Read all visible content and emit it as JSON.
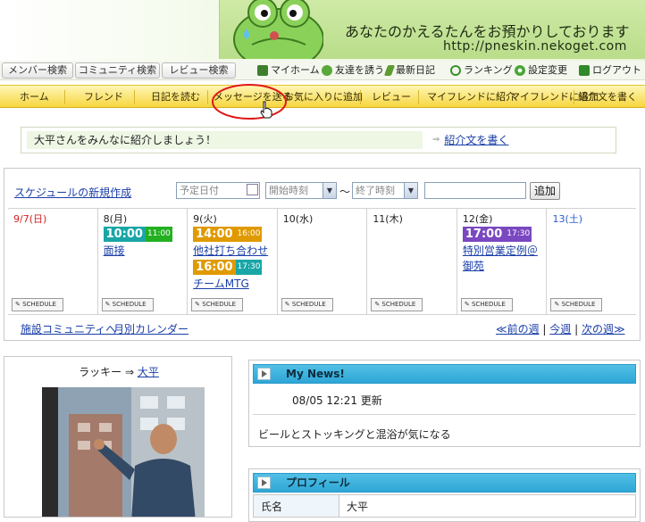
{
  "banner": {
    "title": "あなたのかえるたんをお預かりしております",
    "url": "http://pneskin.nekoget.com"
  },
  "search_tabs": [
    "メンバー検索",
    "コミュニティ検索",
    "レビュー検索"
  ],
  "top_nav": [
    {
      "label": "マイホーム",
      "icon": "home-icon"
    },
    {
      "label": "友達を誘う",
      "icon": "person-icon"
    },
    {
      "label": "最新日記",
      "icon": "pencil-icon"
    },
    {
      "label": "ランキング",
      "icon": "refresh-icon"
    },
    {
      "label": "設定変更",
      "icon": "gear-icon"
    },
    {
      "label": "ログアウト",
      "icon": "exit-icon"
    }
  ],
  "main_nav": [
    "ホーム",
    "フレンド",
    "日記を読む",
    "メッセージを送る",
    "お気に入りに追加",
    "レビュー",
    "マイフレンドに紹介",
    "マイフレンドに追加",
    "紹介文を書く"
  ],
  "intro": {
    "text": "大平さんをみんなに紹介しましょう！",
    "link": "紹介文を書く"
  },
  "schedule": {
    "new_link": "スケジュールの新規作成",
    "date_placeholder": "予定日付",
    "start_placeholder": "開始時刻",
    "tilde": "～",
    "end_placeholder": "終了時刻",
    "add_button": "追加",
    "schedule_btn": "SCHEDULE",
    "days": [
      {
        "label": "9/7(日)",
        "color": "#d42020",
        "events": []
      },
      {
        "label": "8(月)",
        "color": "#222222",
        "events": [
          {
            "start": "10:00",
            "end": "11:00",
            "title": "面接",
            "start_color": "#1aa6a6",
            "end_color": "#23b020"
          }
        ]
      },
      {
        "label": "9(火)",
        "color": "#222222",
        "events": [
          {
            "start": "14:00",
            "end": "16:00",
            "title": "他社打ち合わせ",
            "start_color": "#e09a00",
            "end_color": "#e09a00"
          },
          {
            "start": "16:00",
            "end": "17:30",
            "title": "チームMTG",
            "start_color": "#e09a00",
            "end_color": "#1aa6a6"
          }
        ]
      },
      {
        "label": "10(水)",
        "color": "#222222",
        "events": []
      },
      {
        "label": "11(木)",
        "color": "#222222",
        "events": []
      },
      {
        "label": "12(金)",
        "color": "#222222",
        "events": [
          {
            "start": "17:00",
            "end": "17:30",
            "title": "特別営業定例＠御苑",
            "start_color": "#7a48c0",
            "end_color": "#7a48c0"
          }
        ]
      },
      {
        "label": "13(土)",
        "color": "#2a5bd0",
        "events": []
      }
    ],
    "bottom_left": [
      "施設コミュニティへ",
      "月別カレンダー"
    ],
    "bottom_right": [
      "≪前の週",
      "今週",
      "次の週≫"
    ]
  },
  "profile_card": {
    "from": "ラッキー",
    "arrow": "⇒",
    "to": "大平"
  },
  "my_news": {
    "header": "My News!",
    "updated": "08/05 12:21 更新",
    "text": "ビールとストッキングと混浴が気になる"
  },
  "profile": {
    "header": "プロフィール",
    "key": "氏名",
    "value": "大平"
  }
}
